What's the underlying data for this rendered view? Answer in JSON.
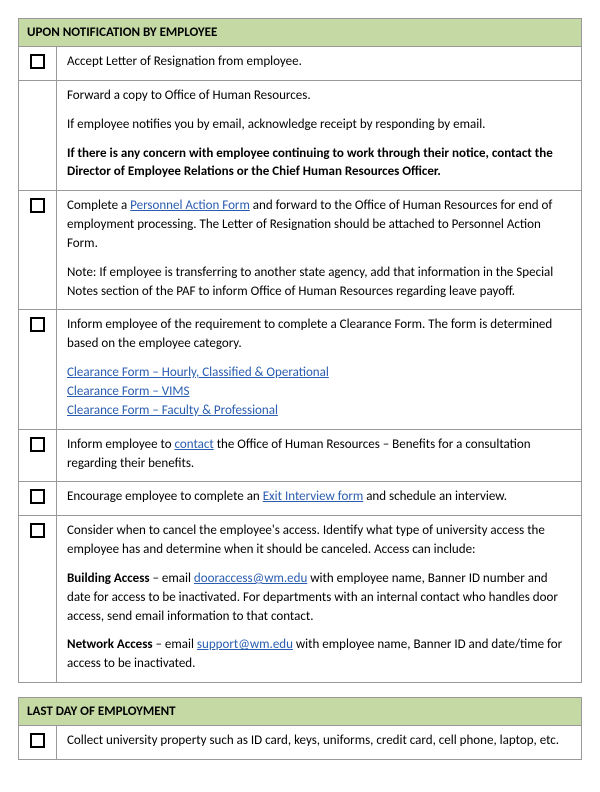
{
  "sections": [
    {
      "title": "UPON NOTIFICATION BY EMPLOYEE",
      "items": [
        {
          "lines": [
            {
              "text": "Accept Letter of Resignation from employee."
            }
          ]
        },
        {
          "nocb": true,
          "lines": [
            {
              "text": "Forward a copy to Office of Human Resources."
            },
            {
              "text": "If employee notifies you by email, acknowledge receipt by responding by email."
            },
            {
              "bold": true,
              "text": "If there is any concern with employee continuing to work through their notice, contact the Director of Employee Relations or the Chief Human Resources Officer."
            }
          ]
        },
        {
          "lines": [
            {
              "parts": [
                {
                  "t": "Complete a "
                },
                {
                  "t": "Personnel Action Form",
                  "link": true
                },
                {
                  "t": " and forward to the Office of Human Resources for end of employment processing.   The Letter of Resignation should be attached to Personnel Action Form."
                }
              ]
            },
            {
              "text": "Note:  If employee is transferring to another state agency, add that information in the Special Notes section of the PAF to inform Office of Human Resources regarding leave payoff."
            }
          ]
        },
        {
          "lines": [
            {
              "text": "Inform employee of the requirement to complete a Clearance Form.  The form is determined based on the employee category."
            },
            {
              "indent": true,
              "parts": [
                {
                  "t": "Clearance Form – Hourly, Classified & Operational",
                  "link": true
                }
              ]
            },
            {
              "indent": true,
              "parts": [
                {
                  "t": "Clearance Form – VIMS",
                  "link": true
                }
              ]
            },
            {
              "indent": true,
              "parts": [
                {
                  "t": "Clearance Form – Faculty & Professional",
                  "link": true
                }
              ]
            }
          ]
        },
        {
          "lines": [
            {
              "parts": [
                {
                  "t": "Inform employee to "
                },
                {
                  "t": "contact",
                  "link": true
                },
                {
                  "t": " the Office of Human Resources – Benefits for a consultation regarding their benefits."
                }
              ]
            }
          ]
        },
        {
          "lines": [
            {
              "parts": [
                {
                  "t": "Encourage employee to complete an "
                },
                {
                  "t": "Exit Interview form",
                  "link": true
                },
                {
                  "t": " and schedule an interview."
                }
              ]
            }
          ]
        },
        {
          "lines": [
            {
              "text": "Consider when to cancel the employee's access.  Identify what type of university access the employee has and determine when it should be canceled.  Access can include:"
            },
            {
              "parts": [
                {
                  "t": "Building Access",
                  "bold": true
                },
                {
                  "t": " – email "
                },
                {
                  "t": "dooraccess@wm.edu",
                  "link": true
                },
                {
                  "t": " with employee name, Banner ID number and date for access to be inactivated.  For departments with an internal contact who handles door access, send email information to that contact."
                }
              ]
            },
            {
              "parts": [
                {
                  "t": "Network Access",
                  "bold": true
                },
                {
                  "t": " – email "
                },
                {
                  "t": "support@wm.edu",
                  "link": true
                },
                {
                  "t": " with employee name, Banner ID and date/time for access to be inactivated."
                }
              ]
            }
          ]
        }
      ]
    },
    {
      "title": "LAST DAY OF EMPLOYMENT",
      "items": [
        {
          "lines": [
            {
              "text": "Collect university property such as ID card, keys, uniforms, credit card, cell phone, laptop, etc."
            }
          ]
        }
      ]
    }
  ]
}
